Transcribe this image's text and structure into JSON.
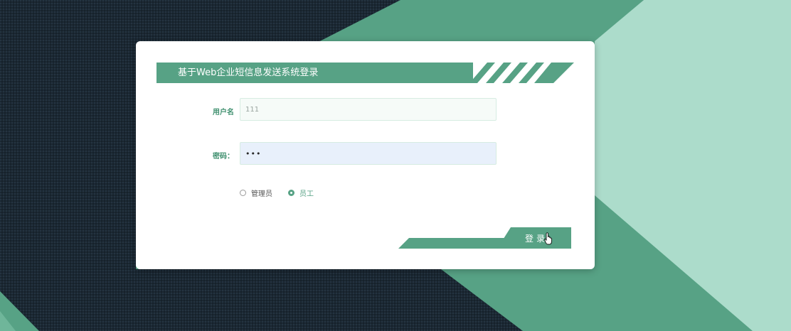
{
  "login": {
    "title": "基于Web企业短信息发送系统登录",
    "username_label": "用户名",
    "username_value": "111",
    "password_label": "密码：",
    "password_value": "•••",
    "role_options": [
      {
        "label": "管理员",
        "selected": false
      },
      {
        "label": "员工",
        "selected": true
      }
    ],
    "submit_label": "登录"
  },
  "icons": {
    "cursor": "hand-pointer-icon"
  },
  "colors": {
    "accent": "#57a285",
    "accent_dark": "#3e8f6e",
    "bg_dark": "#1b2833",
    "bg_mint": "#acdccb",
    "card_bg": "#ffffff"
  }
}
